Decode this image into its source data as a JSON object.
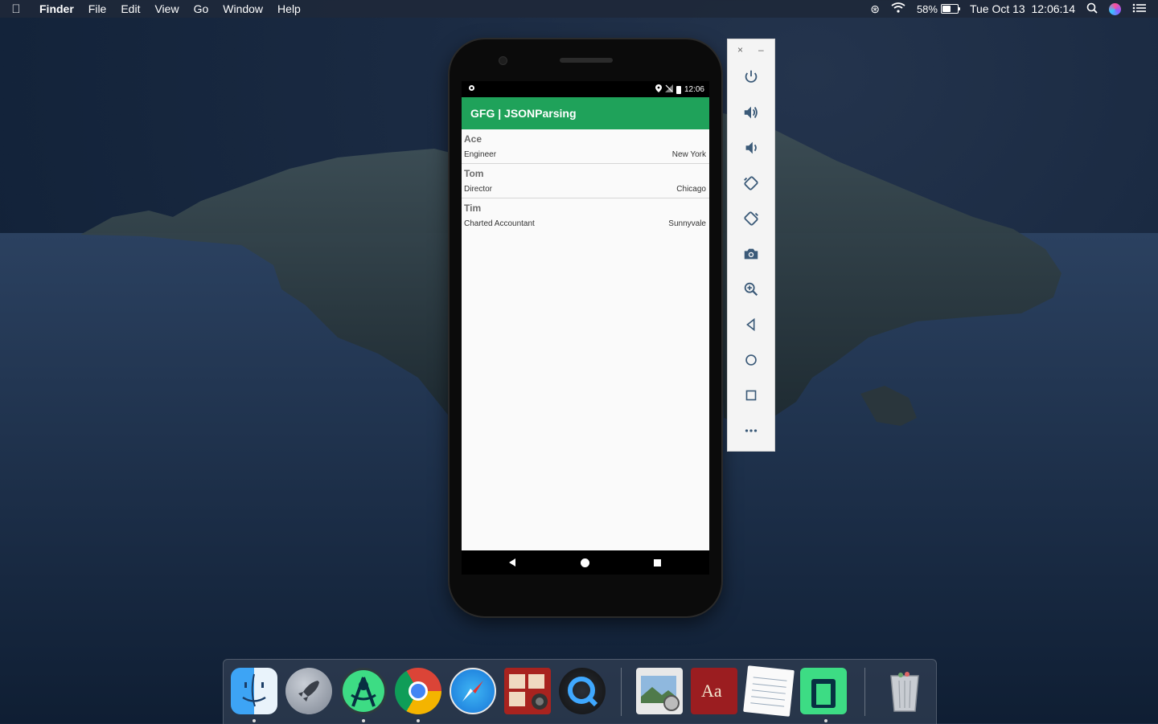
{
  "menubar": {
    "apple_icon": "apple-icon",
    "items": [
      "Finder",
      "File",
      "Edit",
      "View",
      "Go",
      "Window",
      "Help"
    ],
    "battery_percent": "58%",
    "battery_level": 0.58,
    "clock": "Tue Oct 13  12:06:14"
  },
  "phone": {
    "status_time": "12:06",
    "app_title": "GFG | JSONParsing",
    "accent_color": "#1fa25a",
    "rows": [
      {
        "name": "Ace",
        "designation": "Engineer",
        "location": "New York"
      },
      {
        "name": "Tom",
        "designation": "Director",
        "location": "Chicago"
      },
      {
        "name": "Tim",
        "designation": "Charted Accountant",
        "location": "Sunnyvale"
      }
    ]
  },
  "emulator_toolbar": {
    "close_label": "×",
    "minimize_label": "–",
    "buttons": [
      "power-icon",
      "volume-up-icon",
      "volume-down-icon",
      "rotate-left-icon",
      "rotate-right-icon",
      "camera-icon",
      "zoom-icon",
      "back-icon",
      "home-icon",
      "overview-icon",
      "more-icon"
    ]
  },
  "dock": {
    "apps": [
      "Finder",
      "Launchpad",
      "Android Studio",
      "Google Chrome",
      "Safari",
      "Photo Booth",
      "QuickTime Player",
      "Preview",
      "Dictionary",
      "TextEdit",
      "Android Emulator",
      "Trash"
    ],
    "dictionary_label": "Aa"
  }
}
